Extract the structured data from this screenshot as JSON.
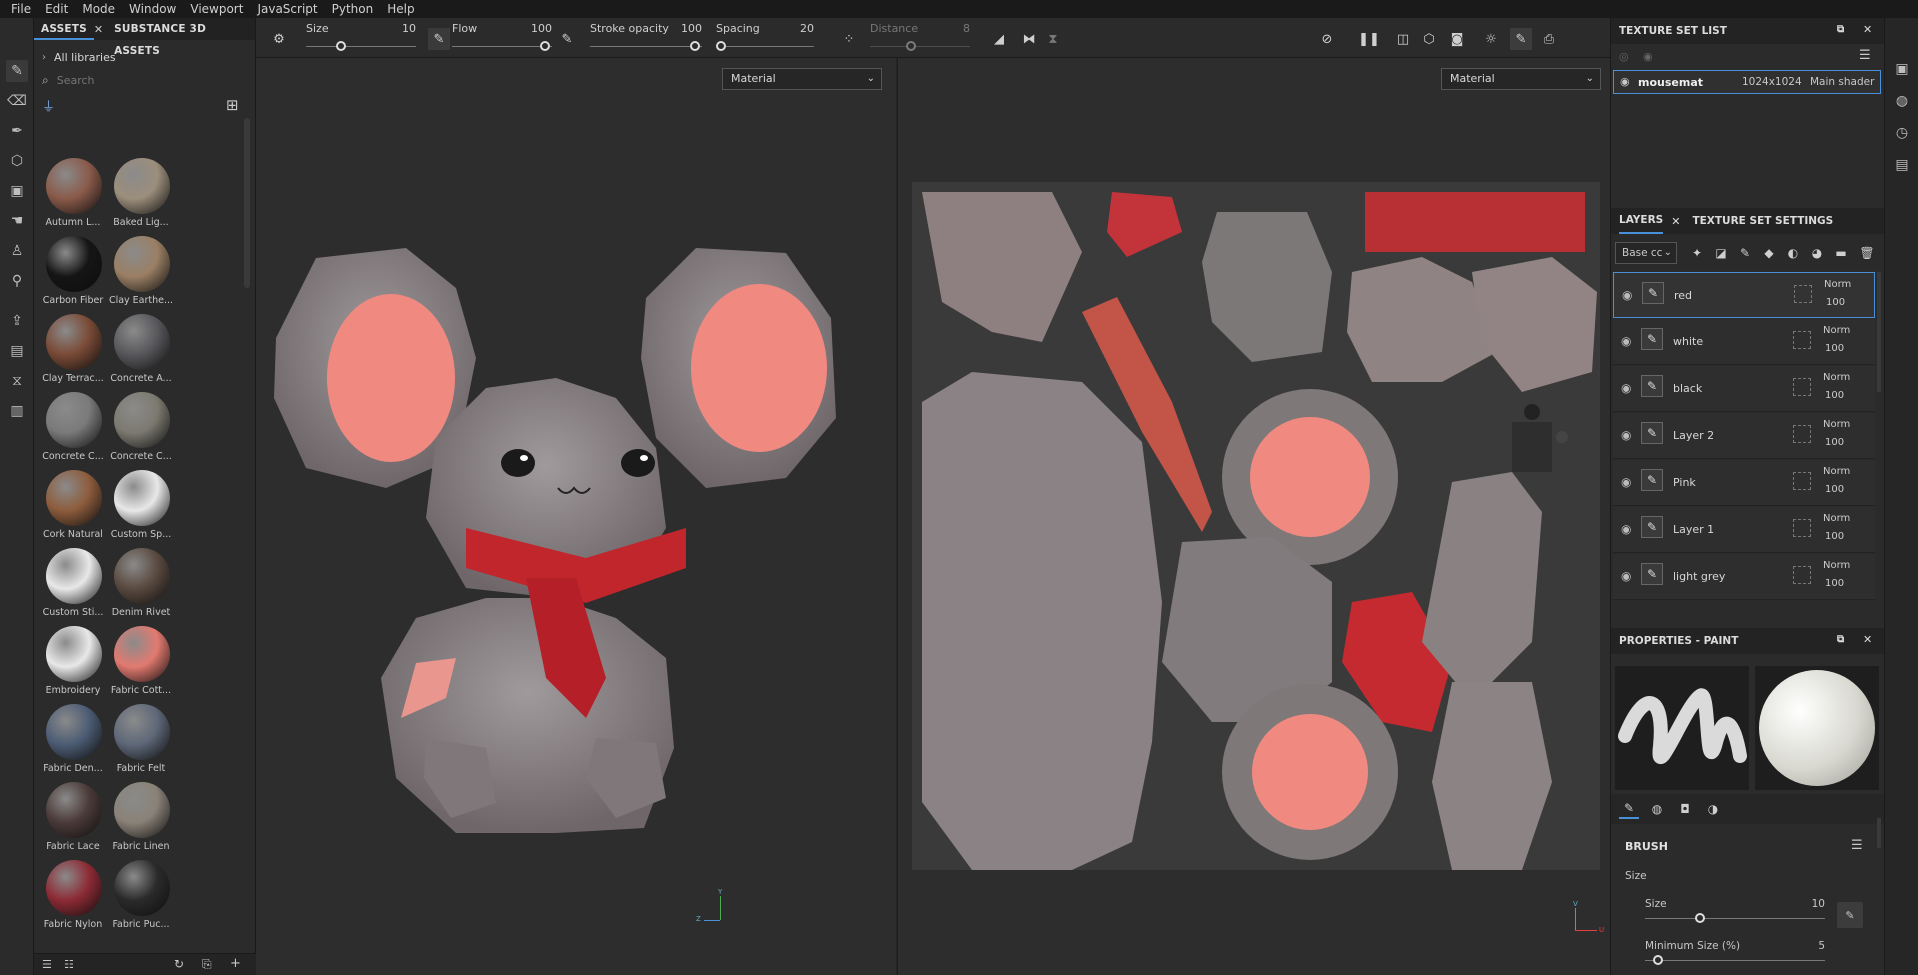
{
  "menu": [
    "File",
    "Edit",
    "Mode",
    "Window",
    "Viewport",
    "JavaScript",
    "Python",
    "Help"
  ],
  "assets_panel": {
    "tabs": [
      "ASSETS",
      "SUBSTANCE 3D ASSETS"
    ],
    "close_glyph": "✕",
    "breadcrumb": "All libraries",
    "search_placeholder": "Search",
    "items": [
      {
        "label": "Autumn L...",
        "color": "#8a5a4a"
      },
      {
        "label": "Baked Lig...",
        "color": "#9c8e7c"
      },
      {
        "label": "Carbon Fiber",
        "color": "#151515"
      },
      {
        "label": "Clay Earthe...",
        "color": "#9a7f64"
      },
      {
        "label": "Clay Terrac...",
        "color": "#7a4a36"
      },
      {
        "label": "Concrete A...",
        "color": "#58585c"
      },
      {
        "label": "Concrete C...",
        "color": "#7a7a7a"
      },
      {
        "label": "Concrete C...",
        "color": "#7c7a70"
      },
      {
        "label": "Cork Natural",
        "color": "#8d5c3c"
      },
      {
        "label": "Custom Sp...",
        "color": "#e8e8e8"
      },
      {
        "label": "Custom Sti...",
        "color": "#e8e8e8"
      },
      {
        "label": "Denim Rivet",
        "color": "#5a4a40"
      },
      {
        "label": "Embroidery",
        "color": "#e8e8e8"
      },
      {
        "label": "Fabric Cott...",
        "color": "#e27a70"
      },
      {
        "label": "Fabric Den...",
        "color": "#4c5c74"
      },
      {
        "label": "Fabric Felt",
        "color": "#5e6878"
      },
      {
        "label": "Fabric Lace",
        "color": "#4a3a38"
      },
      {
        "label": "Fabric Linen",
        "color": "#8a8278"
      },
      {
        "label": "Fabric Nylon",
        "color": "#8c2a34"
      },
      {
        "label": "Fabric Puc...",
        "color": "#2a2a2a"
      }
    ]
  },
  "toolbar": {
    "size_label": "Size",
    "size_value": "10",
    "flow_label": "Flow",
    "flow_value": "100",
    "opacity_label": "Stroke opacity",
    "opacity_value": "100",
    "spacing_label": "Spacing",
    "spacing_value": "20",
    "distance_label": "Distance",
    "distance_value": "8"
  },
  "viewports": {
    "left_mode": "Material",
    "right_mode": "Material",
    "axis_y": "Y",
    "axis_z": "Z",
    "axis_v": "V",
    "axis_u": "U"
  },
  "texture_set_list": {
    "title": "TEXTURE SET LIST",
    "row": {
      "name": "mousemat",
      "size": "1024x1024",
      "shader": "Main shader"
    }
  },
  "layers_panel": {
    "tabs": [
      "LAYERS",
      "TEXTURE SET SETTINGS"
    ],
    "channel": "Base cc",
    "layers": [
      {
        "name": "red",
        "blend": "Norm",
        "opacity": "100"
      },
      {
        "name": "white",
        "blend": "Norm",
        "opacity": "100"
      },
      {
        "name": "black",
        "blend": "Norm",
        "opacity": "100"
      },
      {
        "name": "Layer 2",
        "blend": "Norm",
        "opacity": "100"
      },
      {
        "name": "Pink",
        "blend": "Norm",
        "opacity": "100"
      },
      {
        "name": "Layer 1",
        "blend": "Norm",
        "opacity": "100"
      },
      {
        "name": "light grey",
        "blend": "Norm",
        "opacity": "100"
      }
    ]
  },
  "properties": {
    "title": "PROPERTIES - PAINT",
    "section": "BRUSH",
    "group": "Size",
    "size_label": "Size",
    "size_value": "10",
    "minsize_label": "Minimum Size (%)",
    "minsize_value": "5"
  },
  "colors": {
    "accent": "#4a90d9",
    "pink": "#f08a80",
    "red": "#c0262c",
    "mouse_grey": "#8a8486"
  }
}
